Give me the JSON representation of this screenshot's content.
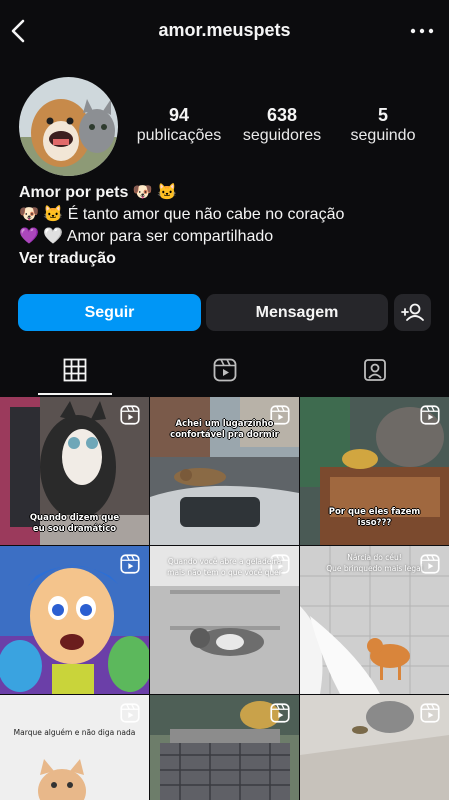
{
  "header": {
    "username": "amor.meuspets",
    "back_icon": "chevron-left-icon",
    "more_icon": "more-horizontal-icon"
  },
  "profile": {
    "stats": [
      {
        "value": "94",
        "label": "publicações"
      },
      {
        "value": "638",
        "label": "seguidores"
      },
      {
        "value": "5",
        "label": "seguindo"
      }
    ],
    "bio": {
      "name": "Amor por pets 🐶 🐱",
      "line1": "🐶 🐱 É tanto amor que não cabe no coração",
      "line2": "💜 🤍 Amor para ser compartilhado",
      "translate": "Ver tradução"
    }
  },
  "actions": {
    "follow_label": "Seguir",
    "message_label": "Mensagem",
    "add_user_icon": "add-user-icon",
    "follow_color": "#0096f6"
  },
  "tabs": [
    {
      "name": "grid",
      "icon": "grid-icon",
      "active": true
    },
    {
      "name": "reels",
      "icon": "reels-icon",
      "active": false
    },
    {
      "name": "tagged",
      "icon": "tagged-user-icon",
      "active": false
    }
  ],
  "posts": [
    {
      "caption": "Quando dizem que\neu sou dramático"
    },
    {
      "caption": "Achei um lugarzinho\nconfortável pra dormir"
    },
    {
      "caption": "Por que eles fazem\nisso???"
    },
    {
      "caption": ""
    },
    {
      "caption": "Quando você abre a geladeira\nmais não tem o que você quer"
    },
    {
      "caption": "Nárcia do céu!\nQue brinquedo mais legal"
    },
    {
      "caption": "Marque alguém e não diga nada"
    },
    {
      "caption": ""
    },
    {
      "caption": ""
    }
  ]
}
